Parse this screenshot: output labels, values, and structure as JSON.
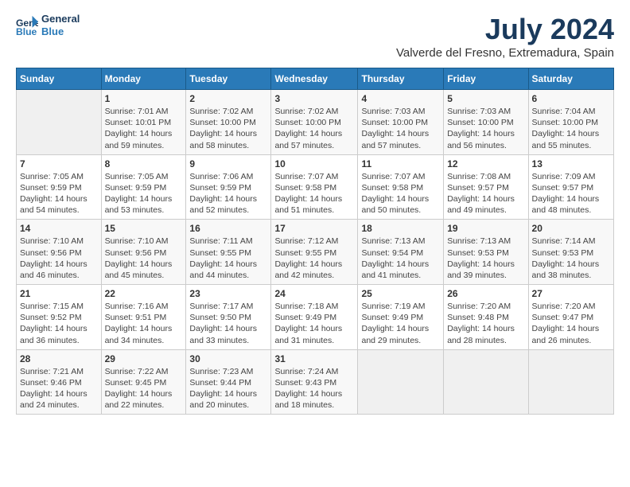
{
  "logo": {
    "line1": "General",
    "line2": "Blue"
  },
  "title": "July 2024",
  "subtitle": "Valverde del Fresno, Extremadura, Spain",
  "headers": [
    "Sunday",
    "Monday",
    "Tuesday",
    "Wednesday",
    "Thursday",
    "Friday",
    "Saturday"
  ],
  "weeks": [
    [
      {
        "day": "",
        "info": ""
      },
      {
        "day": "1",
        "info": "Sunrise: 7:01 AM\nSunset: 10:01 PM\nDaylight: 14 hours\nand 59 minutes."
      },
      {
        "day": "2",
        "info": "Sunrise: 7:02 AM\nSunset: 10:00 PM\nDaylight: 14 hours\nand 58 minutes."
      },
      {
        "day": "3",
        "info": "Sunrise: 7:02 AM\nSunset: 10:00 PM\nDaylight: 14 hours\nand 57 minutes."
      },
      {
        "day": "4",
        "info": "Sunrise: 7:03 AM\nSunset: 10:00 PM\nDaylight: 14 hours\nand 57 minutes."
      },
      {
        "day": "5",
        "info": "Sunrise: 7:03 AM\nSunset: 10:00 PM\nDaylight: 14 hours\nand 56 minutes."
      },
      {
        "day": "6",
        "info": "Sunrise: 7:04 AM\nSunset: 10:00 PM\nDaylight: 14 hours\nand 55 minutes."
      }
    ],
    [
      {
        "day": "7",
        "info": "Sunrise: 7:05 AM\nSunset: 9:59 PM\nDaylight: 14 hours\nand 54 minutes."
      },
      {
        "day": "8",
        "info": "Sunrise: 7:05 AM\nSunset: 9:59 PM\nDaylight: 14 hours\nand 53 minutes."
      },
      {
        "day": "9",
        "info": "Sunrise: 7:06 AM\nSunset: 9:59 PM\nDaylight: 14 hours\nand 52 minutes."
      },
      {
        "day": "10",
        "info": "Sunrise: 7:07 AM\nSunset: 9:58 PM\nDaylight: 14 hours\nand 51 minutes."
      },
      {
        "day": "11",
        "info": "Sunrise: 7:07 AM\nSunset: 9:58 PM\nDaylight: 14 hours\nand 50 minutes."
      },
      {
        "day": "12",
        "info": "Sunrise: 7:08 AM\nSunset: 9:57 PM\nDaylight: 14 hours\nand 49 minutes."
      },
      {
        "day": "13",
        "info": "Sunrise: 7:09 AM\nSunset: 9:57 PM\nDaylight: 14 hours\nand 48 minutes."
      }
    ],
    [
      {
        "day": "14",
        "info": "Sunrise: 7:10 AM\nSunset: 9:56 PM\nDaylight: 14 hours\nand 46 minutes."
      },
      {
        "day": "15",
        "info": "Sunrise: 7:10 AM\nSunset: 9:56 PM\nDaylight: 14 hours\nand 45 minutes."
      },
      {
        "day": "16",
        "info": "Sunrise: 7:11 AM\nSunset: 9:55 PM\nDaylight: 14 hours\nand 44 minutes."
      },
      {
        "day": "17",
        "info": "Sunrise: 7:12 AM\nSunset: 9:55 PM\nDaylight: 14 hours\nand 42 minutes."
      },
      {
        "day": "18",
        "info": "Sunrise: 7:13 AM\nSunset: 9:54 PM\nDaylight: 14 hours\nand 41 minutes."
      },
      {
        "day": "19",
        "info": "Sunrise: 7:13 AM\nSunset: 9:53 PM\nDaylight: 14 hours\nand 39 minutes."
      },
      {
        "day": "20",
        "info": "Sunrise: 7:14 AM\nSunset: 9:53 PM\nDaylight: 14 hours\nand 38 minutes."
      }
    ],
    [
      {
        "day": "21",
        "info": "Sunrise: 7:15 AM\nSunset: 9:52 PM\nDaylight: 14 hours\nand 36 minutes."
      },
      {
        "day": "22",
        "info": "Sunrise: 7:16 AM\nSunset: 9:51 PM\nDaylight: 14 hours\nand 34 minutes."
      },
      {
        "day": "23",
        "info": "Sunrise: 7:17 AM\nSunset: 9:50 PM\nDaylight: 14 hours\nand 33 minutes."
      },
      {
        "day": "24",
        "info": "Sunrise: 7:18 AM\nSunset: 9:49 PM\nDaylight: 14 hours\nand 31 minutes."
      },
      {
        "day": "25",
        "info": "Sunrise: 7:19 AM\nSunset: 9:49 PM\nDaylight: 14 hours\nand 29 minutes."
      },
      {
        "day": "26",
        "info": "Sunrise: 7:20 AM\nSunset: 9:48 PM\nDaylight: 14 hours\nand 28 minutes."
      },
      {
        "day": "27",
        "info": "Sunrise: 7:20 AM\nSunset: 9:47 PM\nDaylight: 14 hours\nand 26 minutes."
      }
    ],
    [
      {
        "day": "28",
        "info": "Sunrise: 7:21 AM\nSunset: 9:46 PM\nDaylight: 14 hours\nand 24 minutes."
      },
      {
        "day": "29",
        "info": "Sunrise: 7:22 AM\nSunset: 9:45 PM\nDaylight: 14 hours\nand 22 minutes."
      },
      {
        "day": "30",
        "info": "Sunrise: 7:23 AM\nSunset: 9:44 PM\nDaylight: 14 hours\nand 20 minutes."
      },
      {
        "day": "31",
        "info": "Sunrise: 7:24 AM\nSunset: 9:43 PM\nDaylight: 14 hours\nand 18 minutes."
      },
      {
        "day": "",
        "info": ""
      },
      {
        "day": "",
        "info": ""
      },
      {
        "day": "",
        "info": ""
      }
    ]
  ]
}
